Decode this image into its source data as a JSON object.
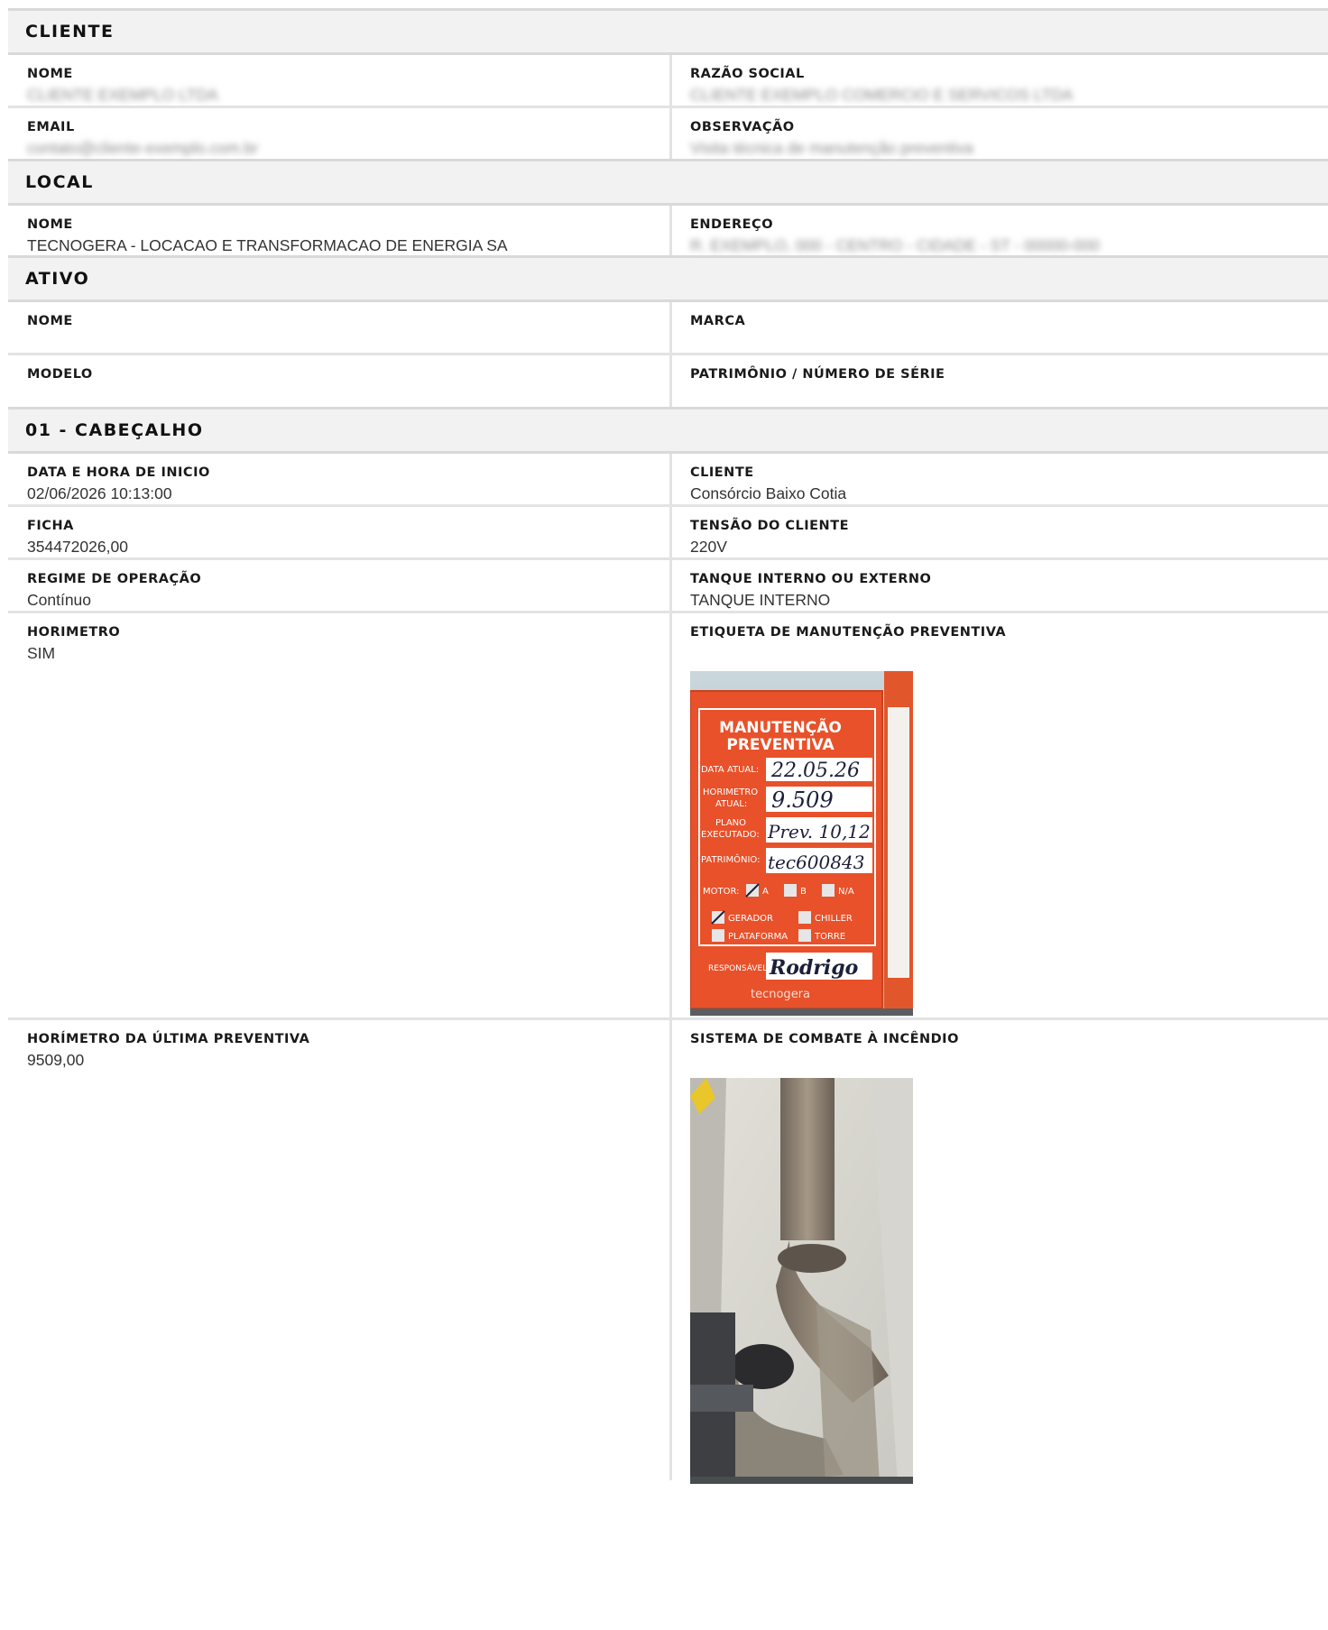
{
  "cliente": {
    "title": "CLIENTE",
    "nome_label": "NOME",
    "nome_value": "CLIENTE EXEMPLO LTDA",
    "razao_label": "RAZÃO SOCIAL",
    "razao_value": "CLIENTE EXEMPLO COMERCIO E SERVICOS LTDA",
    "email_label": "EMAIL",
    "email_value": "contato@cliente-exemplo.com.br",
    "obs_label": "OBSERVAÇÃO",
    "obs_value": "Visita técnica de manutenção preventiva"
  },
  "local": {
    "title": "LOCAL",
    "nome_label": "NOME",
    "nome_value": "TECNOGERA - LOCACAO E TRANSFORMACAO DE ENERGIA SA",
    "endereco_label": "ENDEREÇO",
    "endereco_value": "R. EXEMPLO, 000 - CENTRO - CIDADE - ST - 00000-000"
  },
  "ativo": {
    "title": "ATIVO",
    "nome_label": "NOME",
    "nome_value": "",
    "marca_label": "MARCA",
    "marca_value": "",
    "modelo_label": "MODELO",
    "modelo_value": "",
    "patrimonio_label": "PATRIMÔNIO / NÚMERO DE SÉRIE",
    "patrimonio_value": ""
  },
  "cabecalho": {
    "title": "01 - CABEÇALHO",
    "data_label": "DATA E HORA DE INICIO",
    "data_value": "02/06/2026 10:13:00",
    "cliente_label": "CLIENTE",
    "cliente_value": "Consórcio Baixo Cotia",
    "ficha_label": "FICHA",
    "ficha_value": "354472026,00",
    "tensao_label": "TENSÃO DO CLIENTE",
    "tensao_value": "220V",
    "regime_label": "REGIME DE OPERAÇÃO",
    "regime_value": "Contínuo",
    "tanque_label": "TANQUE INTERNO OU EXTERNO",
    "tanque_value": "TANQUE INTERNO",
    "horimetro_label": "HORIMETRO",
    "horimetro_value": "SIM",
    "etiqueta_label": "ETIQUETA DE MANUTENÇÃO PREVENTIVA",
    "horimetro_ultima_label": "HORÍMETRO DA ÚLTIMA PREVENTIVA",
    "horimetro_ultima_value": "9509,00",
    "incendio_label": "SISTEMA DE COMBATE À INCÊNDIO"
  },
  "etiqueta_photo": {
    "title_line1": "MANUTENÇÃO",
    "title_line2": "PREVENTIVA",
    "data_atual_label": "DATA ATUAL:",
    "data_atual_value": "22.05.26",
    "horimetro_label1": "HORIMETRO",
    "horimetro_label2": "ATUAL:",
    "horimetro_value": "9.509",
    "plano_label1": "PLANO",
    "plano_label2": "EXECUTADO:",
    "plano_value": "Prev. 10,12",
    "patrimonio_label": "PATRIMÔNIO:",
    "patrimonio_value": "tec600843",
    "motor_label": "MOTOR:",
    "motor_a": "A",
    "motor_b": "B",
    "motor_na": "N/A",
    "gerador": "GERADOR",
    "chiller": "CHILLER",
    "plataforma": "PLATAFORMA",
    "torre": "TORRE",
    "responsavel_label": "RESPONSÁVEL:",
    "responsavel_value": "Rodrigo",
    "brand": "tecnogera"
  },
  "colors": {
    "header_bg": "#f2f2f2",
    "border": "#e3e3e3",
    "sticker_orange": "#e8512a"
  }
}
